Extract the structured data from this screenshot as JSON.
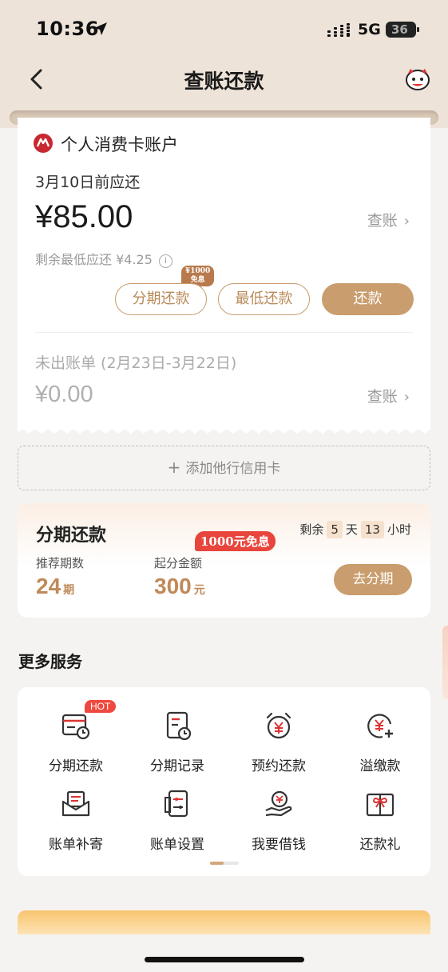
{
  "status_bar": {
    "time": "10:36",
    "network": "5G",
    "battery": "36"
  },
  "nav": {
    "title": "查账还款"
  },
  "bill": {
    "account_title": "个人消费卡账户",
    "due_label": "3月10日前应还",
    "amount": "¥85.00",
    "view_bill": "查账",
    "min_due": "剩余最低应还 ¥4.25",
    "interest_tag_line1": "¥1000",
    "interest_tag_line2": "免息",
    "btn_installment": "分期还款",
    "btn_min_pay": "最低还款",
    "btn_pay": "还款",
    "unbilled_label": "未出账单 (2月23日-3月22日)",
    "unbilled_amount": "¥0.00",
    "unbilled_view": "查账"
  },
  "add_card": {
    "label": "添加他行信用卡"
  },
  "installment": {
    "title": "分期还款",
    "countdown_prefix": "剩余",
    "days": "5",
    "days_unit": "天",
    "hours": "13",
    "hours_unit": "小时",
    "promo": "1000元免息",
    "periods_label": "推荐期数",
    "periods_value": "24",
    "periods_unit": "期",
    "min_amount_label": "起分金额",
    "min_amount_value": "300",
    "min_amount_unit": "元",
    "button": "去分期"
  },
  "more_services": {
    "title": "更多服务",
    "hot_badge": "HOT",
    "items": [
      {
        "label": "分期还款",
        "icon": "installment-bill-icon"
      },
      {
        "label": "分期记录",
        "icon": "record-clock-icon"
      },
      {
        "label": "预约还款",
        "icon": "alarm-yen-icon"
      },
      {
        "label": "溢缴款",
        "icon": "yen-plus-icon"
      },
      {
        "label": "账单补寄",
        "icon": "mail-bill-icon"
      },
      {
        "label": "账单设置",
        "icon": "settings-sliders-icon"
      },
      {
        "label": "我要借钱",
        "icon": "hand-yen-icon"
      },
      {
        "label": "还款礼",
        "icon": "gift-card-icon"
      }
    ]
  },
  "colors": {
    "accent": "#c99d6e",
    "brand_red": "#c8282f",
    "hot": "#f0483e",
    "header_bg": "#eee3d9"
  }
}
